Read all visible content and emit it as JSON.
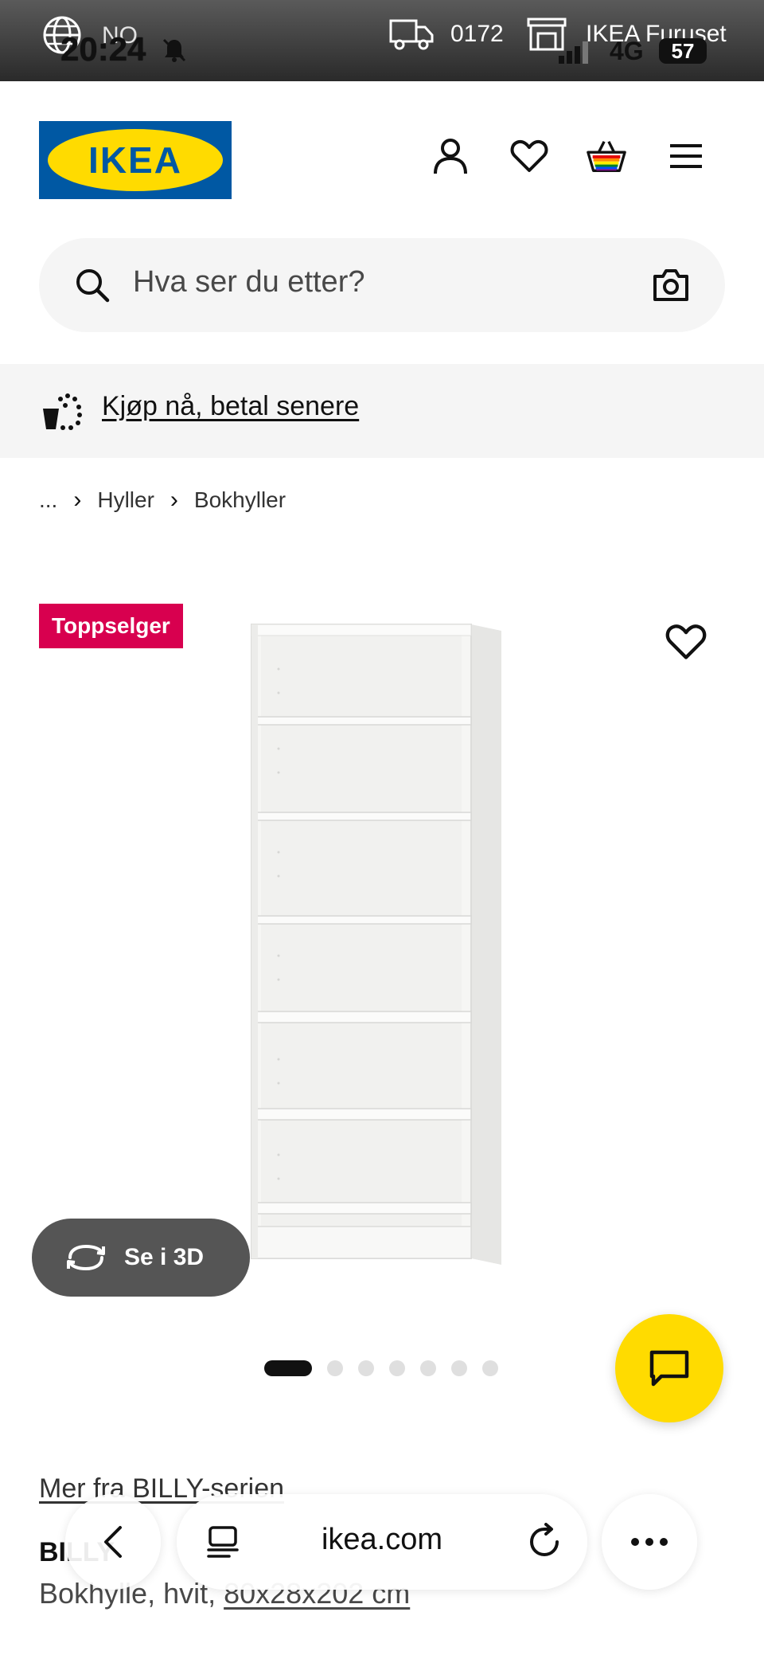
{
  "status_bar": {
    "country": "NO",
    "time": "20:24",
    "zip": "0172",
    "store": "IKEA Furuset",
    "network": "4G",
    "battery": "57"
  },
  "header": {
    "logo_text": "IKEA",
    "brand_colors": {
      "blue": "#0058a3",
      "yellow": "#ffdb00"
    },
    "icons": [
      "profile-icon",
      "heart-icon",
      "cart-icon",
      "menu-icon"
    ]
  },
  "search": {
    "placeholder": "Hva ser du etter?"
  },
  "promo": {
    "text": "Kjøp nå, betal senere"
  },
  "breadcrumb": {
    "items": [
      "...",
      "Hyller",
      "Bokhyller"
    ]
  },
  "product": {
    "badge": "Toppselger",
    "badge_color": "#d8004f",
    "view_3d_label": "Se i 3D",
    "image_count": 7,
    "active_image": 1,
    "series_link": "Mer fra BILLY-serien",
    "name": "BILLY",
    "desc_prefix": "Bokhylle, hvit, ",
    "desc_dims": "80x28x202 cm"
  },
  "browser": {
    "domain": "ikea.com"
  }
}
